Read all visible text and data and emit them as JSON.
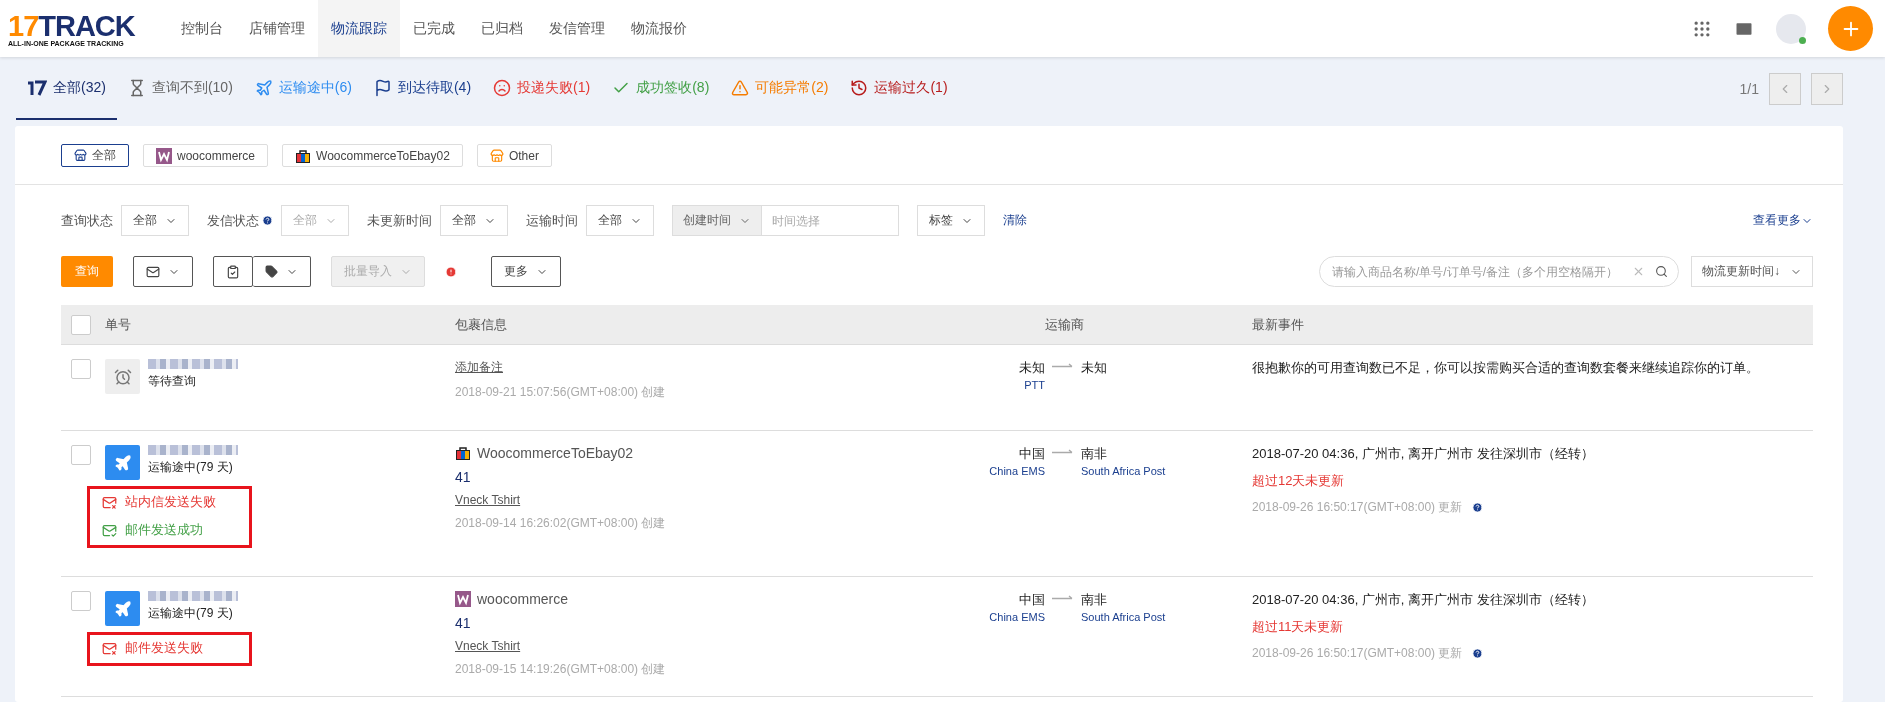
{
  "logo": {
    "number": "17",
    "word": "TRACK",
    "tagline": "ALL-IN-ONE PACKAGE TRACKING"
  },
  "nav": [
    {
      "label": "控制台",
      "selected": false
    },
    {
      "label": "店铺管理",
      "selected": false
    },
    {
      "label": "物流跟踪",
      "selected": true
    },
    {
      "label": "已完成",
      "selected": false
    },
    {
      "label": "已归档",
      "selected": false
    },
    {
      "label": "发信管理",
      "selected": false
    },
    {
      "label": "物流报价",
      "selected": false
    }
  ],
  "status_tabs": [
    {
      "kind": "all",
      "label": "全部(32)",
      "color": "#1b2f6e",
      "selected": true
    },
    {
      "kind": "notfound",
      "label": "查询不到(10)",
      "color": "#666666",
      "selected": false
    },
    {
      "kind": "transit",
      "label": "运输途中(6)",
      "color": "#2d8cf0",
      "selected": false
    },
    {
      "kind": "pickup",
      "label": "到达待取(4)",
      "color": "#1b3f8f",
      "selected": false
    },
    {
      "kind": "failed",
      "label": "投递失败(1)",
      "color": "#e53935",
      "selected": false
    },
    {
      "kind": "delivered",
      "label": "成功签收(8)",
      "color": "#43a047",
      "selected": false
    },
    {
      "kind": "alert",
      "label": "可能异常(2)",
      "color": "#f57c00",
      "selected": false
    },
    {
      "kind": "expired",
      "label": "运输过久(1)",
      "color": "#b71c1c",
      "selected": false
    }
  ],
  "pager": "1/1",
  "store_filters": [
    {
      "kind": "all",
      "label": "全部",
      "selected": true
    },
    {
      "kind": "woo",
      "label": "woocommerce",
      "selected": false
    },
    {
      "kind": "ebay",
      "label": "WoocommerceToEbay02",
      "selected": false
    },
    {
      "kind": "other",
      "label": "Other",
      "selected": false
    }
  ],
  "filters": [
    {
      "label": "查询状态",
      "value": "全部",
      "help": false,
      "disabled": false
    },
    {
      "label": "发信状态",
      "value": "全部",
      "help": true,
      "disabled": true
    },
    {
      "label": "未更新时间",
      "value": "全部",
      "help": false,
      "disabled": false
    },
    {
      "label": "运输时间",
      "value": "全部",
      "help": false,
      "disabled": false
    }
  ],
  "date_filter": {
    "mode": "创建时间",
    "placeholder": "时间选择"
  },
  "tag_filter": "标签",
  "clear": "清除",
  "see_more": "查看更多",
  "actions": {
    "query": "查询",
    "import": "批量导入",
    "import_disabled": true,
    "more": "更多"
  },
  "search": {
    "placeholder": "请输入商品名称/单号/订单号/备注（多个用空格隔开）"
  },
  "sort": "物流更新时间↓",
  "table": {
    "select_all_checked": false,
    "columns": [
      "单号",
      "包裹信息",
      "运输商",
      "最新事件"
    ],
    "rows": [
      {
        "checked": false,
        "kind": "pending",
        "status": "等待查询",
        "package": {
          "note": "添加备注",
          "created": "2018-09-21 15:07:56(GMT+08:00) 创建"
        },
        "origin": {
          "country": "未知",
          "carrier": "PTT"
        },
        "destination": {
          "country": "未知"
        },
        "event": {
          "text": "很抱歉你的可用查询数已不足，你可以按需购买合适的查询数套餐来继续追踪你的订单。"
        }
      },
      {
        "checked": false,
        "kind": "transit",
        "status": "运输途中(79 天)",
        "notices_highlighted": true,
        "notices": [
          {
            "kind": "fail",
            "text": "站内信发送失败"
          },
          {
            "kind": "success",
            "text": "邮件发送成功"
          }
        ],
        "package": {
          "kind": "ebay",
          "store": "WoocommerceToEbay02",
          "quantity": "41",
          "product": "Vneck Tshirt",
          "created": "2018-09-14 16:26:02(GMT+08:00) 创建"
        },
        "origin": {
          "country": "中国",
          "carrier": "China EMS"
        },
        "destination": {
          "country": "南非",
          "carrier": "South Africa Post"
        },
        "event": {
          "text": "2018-07-20 04:36, 广州市, 离开广州市 发往深圳市（经转）",
          "warning": "超过12天未更新",
          "updated": "2018-09-26 16:50:17(GMT+08:00) 更新"
        }
      },
      {
        "checked": false,
        "kind": "transit",
        "status": "运输途中(79 天)",
        "notices_highlighted": true,
        "notices": [
          {
            "kind": "fail",
            "text": "邮件发送失败"
          }
        ],
        "package": {
          "kind": "woo",
          "store": "woocommerce",
          "quantity": "41",
          "product": "Vneck Tshirt",
          "created": "2018-09-15 14:19:26(GMT+08:00) 创建"
        },
        "origin": {
          "country": "中国",
          "carrier": "China EMS"
        },
        "destination": {
          "country": "南非",
          "carrier": "South Africa Post"
        },
        "event": {
          "text": "2018-07-20 04:36, 广州市, 离开广州市 发往深圳市（经转）",
          "warning": "超过11天未更新",
          "updated": "2018-09-26 16:50:17(GMT+08:00) 更新"
        }
      }
    ]
  }
}
